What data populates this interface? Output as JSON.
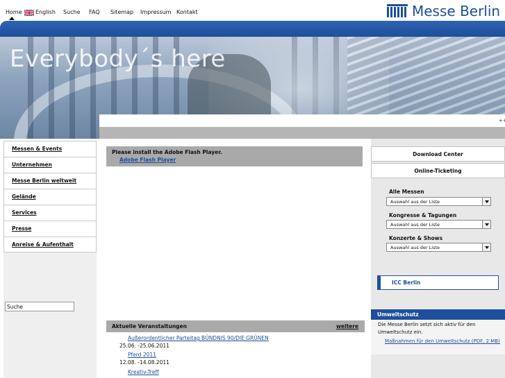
{
  "topnav": {
    "home": "Home",
    "english": "English",
    "suche": "Suche",
    "faq": "FAQ",
    "sitemap": "Sitemap",
    "impressum": "Impressum",
    "kontakt": "Kontakt"
  },
  "logo": {
    "text": "Messe Berlin"
  },
  "hero": {
    "slogan": "Everybody´s here"
  },
  "misc": {
    "plusplus": "++"
  },
  "leftnav": {
    "items": [
      "Messen & Events",
      "Unternehmen",
      "Messe Berlin weltweit",
      "Gelände",
      "Services",
      "Presse",
      "Anreise & Aufenthalt"
    ]
  },
  "search": {
    "value": "Suche"
  },
  "flash": {
    "title": "Please install the Adobe Flash Player.",
    "link": "Adobe Flash Player"
  },
  "events": {
    "title": "Aktuelle Veranstaltungen",
    "more": "weitere",
    "items": [
      {
        "name": "Außerordentlicher Parteitag BÜNDNIS 90/DIE GRÜNEN",
        "date": "25.06. -25.06.2011"
      },
      {
        "name": "Pferd 2011",
        "date": "12.08. -14.08.2011"
      },
      {
        "name": "Kreativ-Treff",
        "date": ""
      }
    ]
  },
  "right": {
    "download_center": "Download Center",
    "online_ticketing": "Online-Ticketing",
    "filters": [
      {
        "label": "Alle Messen",
        "selected": "Auswahl aus der Liste"
      },
      {
        "label": "Kongresse & Tagungen",
        "selected": "Auswahl aus der Liste"
      },
      {
        "label": "Konzerte & Shows",
        "selected": "Auswahl aus der Liste"
      }
    ],
    "icc": "ICC Berlin"
  },
  "umwelt": {
    "title": "Umweltschutz",
    "text": "Die Messe Berlin setzt sich aktiv für den Umweltschutz ein.",
    "link": "Maßnahmen für den Umweltschutz (PDF, 2 MB)"
  },
  "colors": {
    "brand_blue": "#1d4f9c",
    "grey_bar": "#a9a9a9",
    "panel_grey": "#e8e8e8"
  },
  "icons": {
    "flag": "uk-flag-icon",
    "home_marker": "caret-up-icon",
    "dropdown": "chevron-down-icon"
  }
}
